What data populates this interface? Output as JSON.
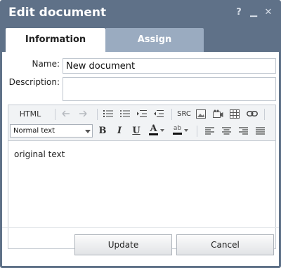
{
  "window": {
    "title": "Edit document",
    "help_glyph": "?",
    "minimize_glyph": "▁",
    "close_glyph": "✕"
  },
  "tabs": [
    {
      "label": "Information",
      "active": true
    },
    {
      "label": "Assign",
      "active": false
    }
  ],
  "form": {
    "name_label": "Name:",
    "name_value": "New document",
    "description_label": "Description:",
    "description_value": ""
  },
  "editor": {
    "html_label": "HTML",
    "src_label": "SRC",
    "format_select_value": "Normal text",
    "bold_glyph": "B",
    "italic_glyph": "I",
    "underline_glyph": "U",
    "font_color_glyph": "A",
    "highlight_glyph": "ab",
    "content_text": "original text"
  },
  "actions": {
    "update_label": "Update",
    "cancel_label": "Cancel"
  },
  "colors": {
    "titlebar": "#5f7188",
    "inactive_tab": "#9aabc0",
    "font_color_underline": "#111111",
    "highlight_underline": "#111111"
  }
}
